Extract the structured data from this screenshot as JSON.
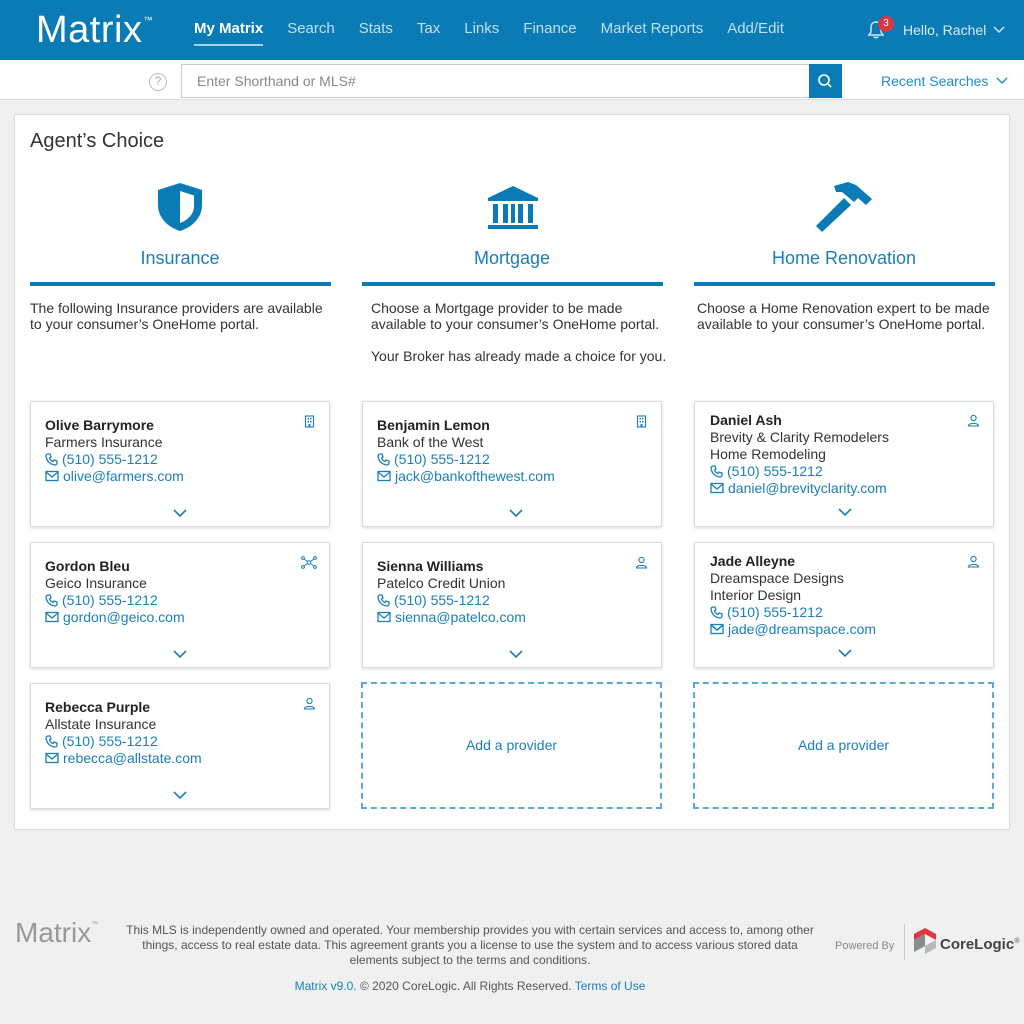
{
  "header": {
    "logo": "Matrix",
    "logo_tm": "™",
    "nav": [
      "My Matrix",
      "Search",
      "Stats",
      "Tax",
      "Links",
      "Finance",
      "Market Reports",
      "Add/Edit"
    ],
    "notification_count": "3",
    "greeting": "Hello, Rachel",
    "accent_color": "#0b7bb5"
  },
  "search": {
    "help_glyph": "?",
    "placeholder": "Enter Shorthand or MLS#",
    "value": "",
    "recent_label": "Recent Searches"
  },
  "main": {
    "title": "Agent’s Choice",
    "columns": [
      {
        "icon": "shield-icon",
        "title": "Insurance",
        "desc": "The following Insurance providers are available to your consumer’s OneHome portal.",
        "desc2": "",
        "cards": [
          {
            "name": "Olive Barrymore",
            "line1": "Farmers Insurance",
            "line2": "",
            "phone": "(510) 555-1212",
            "email": "olive@farmers.com",
            "corner": "building-icon"
          },
          {
            "name": "Gordon Bleu",
            "line1": "Geico Insurance",
            "line2": "",
            "phone": "(510) 555-1212",
            "email": "gordon@geico.com",
            "corner": "network-icon"
          },
          {
            "name": "Rebecca Purple",
            "line1": "Allstate Insurance",
            "line2": "",
            "phone": "(510) 555-1212",
            "email": "rebecca@allstate.com",
            "corner": "person-icon"
          }
        ],
        "add_label": ""
      },
      {
        "icon": "bank-icon",
        "title": "Mortgage",
        "desc": "Choose a Mortgage provider to be made available to your consumer’s OneHome portal.",
        "desc2": "Your Broker has already made a choice for you.",
        "cards": [
          {
            "name": "Benjamin Lemon",
            "line1": "Bank of the West",
            "line2": "",
            "phone": "(510) 555-1212",
            "email": "jack@bankofthewest.com",
            "corner": "building-icon"
          },
          {
            "name": "Sienna Williams",
            "line1": "Patelco Credit Union",
            "line2": "",
            "phone": "(510) 555-1212",
            "email": "sienna@patelco.com",
            "corner": "person-icon"
          }
        ],
        "add_label": "Add a provider"
      },
      {
        "icon": "hammer-icon",
        "title": "Home Renovation",
        "desc": "Choose a Home Renovation expert to be made available to your consumer’s OneHome portal.",
        "desc2": "",
        "cards": [
          {
            "name": "Daniel Ash",
            "line1": "Brevity & Clarity Remodelers",
            "line2": "Home Remodeling",
            "phone": "(510) 555-1212",
            "email": "daniel@brevityclarity.com",
            "corner": "person-icon"
          },
          {
            "name": "Jade Alleyne",
            "line1": "Dreamspace Designs",
            "line2": "Interior Design",
            "phone": "(510) 555-1212",
            "email": "jade@dreamspace.com",
            "corner": "person-icon"
          }
        ],
        "add_label": "Add a provider"
      }
    ]
  },
  "footer": {
    "logo": "Matrix",
    "logo_tm": "™",
    "disclaimer": "This MLS is independently owned and operated. Your membership provides you with certain services and access to, among other things, access to real estate data. This agreement grants you a license to use the system and to access various stored data elements subject to the terms and conditions.",
    "version_link": "Matrix v9.0.",
    "copyright": " © 2020 CoreLogic. All Rights Reserved. ",
    "terms_link": "Terms of Use",
    "powered_by": "Powered By",
    "brand": "CoreLogic",
    "brand_mark": "®"
  }
}
